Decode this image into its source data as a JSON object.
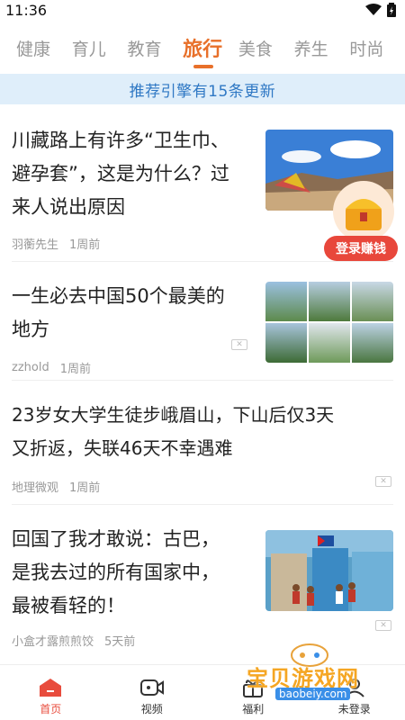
{
  "status_bar": {
    "time": "11:36"
  },
  "tabs": [
    {
      "label": "健康"
    },
    {
      "label": "育儿"
    },
    {
      "label": "教育"
    },
    {
      "label": "旅行",
      "active": true
    },
    {
      "label": "美食"
    },
    {
      "label": "养生"
    },
    {
      "label": "时尚"
    }
  ],
  "banner": {
    "text": "推荐引擎有15条更新"
  },
  "articles": [
    {
      "title_line1": "川藏路上有许多“卫生巾、",
      "title_line2": "避孕套”，这是为什么？过",
      "title_line3": "来人说出原因",
      "author": "羽蘅先生",
      "time": "1周前"
    },
    {
      "title_line1": "一生必去中国50个最美的",
      "title_line2": "地方",
      "author": "zzhold",
      "time": "1周前"
    },
    {
      "title_line1": "23岁女大学生徒步峨眉山，下山后仅3天",
      "title_line2": "又折返，失联46天不幸遇难",
      "author": "地理微观",
      "time": "1周前"
    },
    {
      "title_line1": "回国了我才敢说：古巴，",
      "title_line2": "是我去过的所有国家中，",
      "title_line3": "最被看轻的！",
      "author": "小盒才露煎煎饺",
      "time": "5天前"
    }
  ],
  "promo": {
    "label": "登录赚钱"
  },
  "bottom_nav": [
    {
      "label": "首页",
      "icon": "home-icon",
      "active": true
    },
    {
      "label": "视频",
      "icon": "video-icon"
    },
    {
      "label": "福利",
      "icon": "gift-icon"
    },
    {
      "label": "未登录",
      "icon": "user-icon"
    }
  ],
  "watermark": {
    "text": "宝贝游戏网",
    "url": "baobeiy.com"
  },
  "colors": {
    "accent": "#e8702a",
    "banner_bg": "#dfeefa",
    "banner_text": "#2f78c4",
    "nav_active": "#e84c3d"
  }
}
